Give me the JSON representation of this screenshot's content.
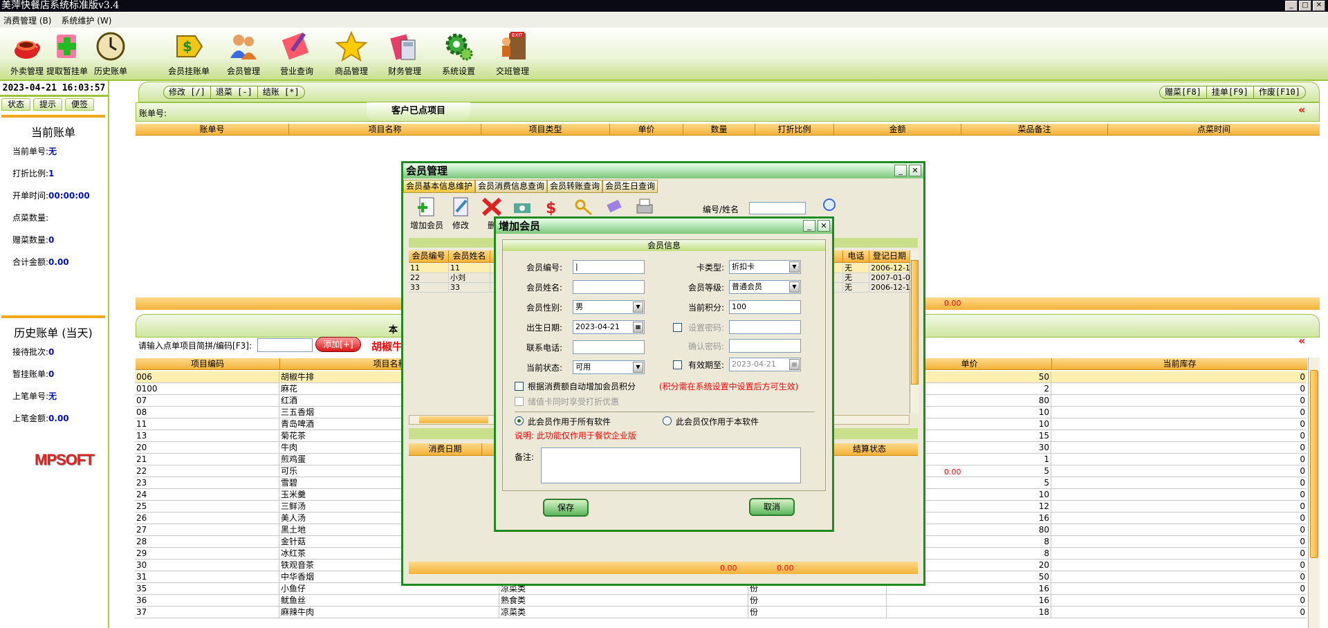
{
  "app": {
    "title": "美萍快餐店系统标准版v3.4"
  },
  "menu": [
    "消费管理 (B)",
    "系统维护 (W)"
  ],
  "toolbar": [
    {
      "label": "外卖管理",
      "icon": "cup-icon"
    },
    {
      "label": "提取暂挂单",
      "icon": "add-cross-icon"
    },
    {
      "label": "历史账单",
      "icon": "clock-icon"
    },
    {
      "label": "会员挂账单",
      "icon": "dollar-tag-icon"
    },
    {
      "label": "会员管理",
      "icon": "people-icon"
    },
    {
      "label": "营业查询",
      "icon": "magnifier-pen-icon"
    },
    {
      "label": "商品管理",
      "icon": "star-icon"
    },
    {
      "label": "财务管理",
      "icon": "calculator-icon"
    },
    {
      "label": "系统设置",
      "icon": "gear-icon"
    },
    {
      "label": "交班管理",
      "icon": "exit-person-icon"
    }
  ],
  "left": {
    "datetime": "2023-04-21 16:03:57",
    "tabs": [
      "状态",
      "提示",
      "便签"
    ],
    "current_bill": {
      "title": "当前账单",
      "rows": [
        {
          "label": "当前单号:",
          "value": "无"
        },
        {
          "label": "打折比例:",
          "value": "1"
        },
        {
          "label": "开单时间:",
          "value": "00:00:00"
        },
        {
          "label": "点菜数量:",
          "value": ""
        },
        {
          "label": "赠菜数量:",
          "value": "0"
        },
        {
          "label": "合计金额:",
          "value": "0.00"
        }
      ]
    },
    "history": {
      "title": "历史账单 (当天)",
      "rows": [
        {
          "label": "接待批次:",
          "value": "0"
        },
        {
          "label": "暂挂账单:",
          "value": "0"
        },
        {
          "label": "上笔单号:",
          "value": "无"
        },
        {
          "label": "上笔金额:",
          "value": "0.00"
        }
      ]
    },
    "logo": "MPSOFT"
  },
  "order": {
    "actions_left": [
      "修改 [/]",
      "退菜 [-]",
      "结账 [*]"
    ],
    "actions_right": [
      "赠菜[F8]",
      "挂单[F9]",
      "作废[F10]"
    ],
    "bill_label": "账单号:",
    "section_title": "客户已点项目",
    "columns": [
      "账单号",
      "项目名称",
      "项目类型",
      "单价",
      "数量",
      "打折比例",
      "金额",
      "菜品备注",
      "点菜时间"
    ],
    "total": "0.00"
  },
  "items": {
    "section_title": "本",
    "input_label": "请输入点单项目简拼/编码[F3]:",
    "add_button": "添加[+]",
    "selected_name": "胡椒牛",
    "columns": [
      "项目编码",
      "项目名称",
      "",
      "",
      "单价",
      "当前库存"
    ],
    "rows": [
      {
        "code": "006",
        "name": "胡椒牛排",
        "type": "",
        "unit": "",
        "price": "50",
        "stock": "0"
      },
      {
        "code": "0100",
        "name": "麻花",
        "type": "",
        "unit": "",
        "price": "2",
        "stock": "0"
      },
      {
        "code": "07",
        "name": "红酒",
        "type": "",
        "unit": "",
        "price": "80",
        "stock": "0"
      },
      {
        "code": "08",
        "name": "三五香烟",
        "type": "",
        "unit": "",
        "price": "10",
        "stock": "0"
      },
      {
        "code": "11",
        "name": "青岛啤酒",
        "type": "",
        "unit": "",
        "price": "10",
        "stock": "0"
      },
      {
        "code": "13",
        "name": "菊花茶",
        "type": "",
        "unit": "",
        "price": "15",
        "stock": "0"
      },
      {
        "code": "20",
        "name": "牛肉",
        "type": "",
        "unit": "",
        "price": "30",
        "stock": "0"
      },
      {
        "code": "21",
        "name": "煎鸡蛋",
        "type": "",
        "unit": "",
        "price": "1",
        "stock": "0"
      },
      {
        "code": "22",
        "name": "可乐",
        "type": "",
        "unit": "",
        "price": "5",
        "stock": "0"
      },
      {
        "code": "23",
        "name": "雪碧",
        "type": "",
        "unit": "",
        "price": "5",
        "stock": "0"
      },
      {
        "code": "24",
        "name": "玉米羹",
        "type": "",
        "unit": "",
        "price": "10",
        "stock": "0"
      },
      {
        "code": "25",
        "name": "三鲜汤",
        "type": "",
        "unit": "",
        "price": "12",
        "stock": "0"
      },
      {
        "code": "26",
        "name": "美人汤",
        "type": "",
        "unit": "",
        "price": "16",
        "stock": "0"
      },
      {
        "code": "27",
        "name": "黑土地",
        "type": "",
        "unit": "",
        "price": "80",
        "stock": "0"
      },
      {
        "code": "28",
        "name": "金针菇",
        "type": "",
        "unit": "",
        "price": "8",
        "stock": "0"
      },
      {
        "code": "29",
        "name": "冰红茶",
        "type": "",
        "unit": "",
        "price": "8",
        "stock": "0"
      },
      {
        "code": "30",
        "name": "铁观音茶",
        "type": "",
        "unit": "",
        "price": "20",
        "stock": "0"
      },
      {
        "code": "31",
        "name": "中华香烟",
        "type": "",
        "unit": "",
        "price": "50",
        "stock": "0"
      },
      {
        "code": "35",
        "name": "小鱼仔",
        "type": "凉菜类",
        "unit": "份",
        "price": "16",
        "stock": "0"
      },
      {
        "code": "36",
        "name": "鱿鱼丝",
        "type": "熟食类",
        "unit": "份",
        "price": "16",
        "stock": "0"
      },
      {
        "code": "37",
        "name": "麻辣牛肉",
        "type": "凉菜类",
        "unit": "份",
        "price": "18",
        "stock": "0"
      }
    ]
  },
  "member_mgmt": {
    "title": "会员管理",
    "tabs": [
      "会员基本信息维护",
      "会员消费信息查询",
      "会员转账查询",
      "会员生日查询"
    ],
    "tools": [
      "增加会员",
      "修改",
      "删"
    ],
    "search_label": "编号/姓名",
    "columns": [
      "会员编号",
      "会员姓名",
      "",
      "电话",
      "登记日期"
    ],
    "rows": [
      {
        "id": "11",
        "name": "11",
        "phone": "无",
        "date": "2006-12-1"
      },
      {
        "id": "22",
        "name": "小刘",
        "phone": "无",
        "date": "2007-01-0"
      },
      {
        "id": "33",
        "name": "33",
        "phone": "无",
        "date": "2006-12-1"
      }
    ],
    "total": "0.00",
    "lower_columns": [
      "消费日期",
      "",
      "结算状态"
    ],
    "footer": [
      "0.00",
      "0.00"
    ]
  },
  "add_member": {
    "title": "增加会员",
    "section": "会员信息",
    "labels": {
      "member_no": "会员编号:",
      "member_name": "会员姓名:",
      "gender": "会员性别:",
      "birth": "出生日期:",
      "phone": "联系电话:",
      "status": "当前状态:",
      "card_type": "卡类型:",
      "level": "会员等级:",
      "points": "当前积分:",
      "set_password": "设置密码:",
      "confirm_password": "确认密码:",
      "expire": "有效期至:"
    },
    "values": {
      "member_no": "|",
      "member_name": "",
      "gender": "男",
      "birth": "2023-04-21",
      "phone": "",
      "status": "可用",
      "card_type": "折扣卡",
      "level": "普通会员",
      "points": "100",
      "set_password": "",
      "confirm_password": "",
      "expire": "2023-04-21"
    },
    "auto_points": "根据消费额自动增加会员积分",
    "auto_points_note": "(积分需在系统设置中设置后方可生效)",
    "stored_discount": "储值卡同时享受打折优惠",
    "scope_all": "此会员作用于所有软件",
    "scope_this": "此会员仅作用于本软件",
    "note": "说明: 此功能仅作用于餐饮企业版",
    "remark_label": "备注:",
    "save": "保存",
    "cancel": "取消"
  }
}
